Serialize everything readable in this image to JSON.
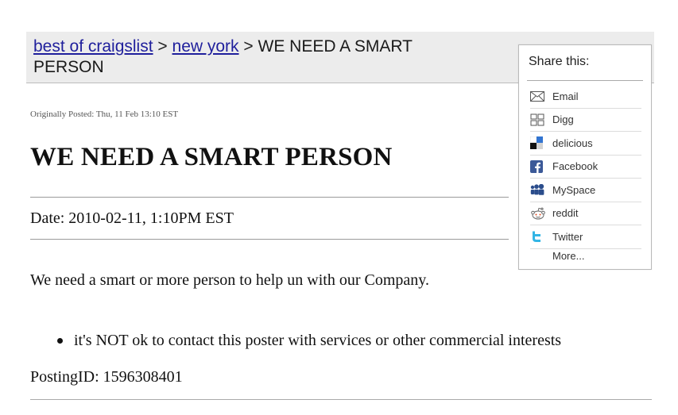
{
  "breadcrumb": {
    "link1": "best of craigslist",
    "sep1": ">",
    "link2": "new york",
    "sep2": ">",
    "current": "WE NEED A SMART PERSON"
  },
  "share": {
    "title": "Share this:",
    "items": [
      {
        "label": "Email",
        "icon": "email-icon"
      },
      {
        "label": "Digg",
        "icon": "digg-icon"
      },
      {
        "label": "delicious",
        "icon": "delicious-icon"
      },
      {
        "label": "Facebook",
        "icon": "facebook-icon"
      },
      {
        "label": "MySpace",
        "icon": "myspace-icon"
      },
      {
        "label": "reddit",
        "icon": "reddit-icon"
      },
      {
        "label": "Twitter",
        "icon": "twitter-icon"
      }
    ],
    "more": "More..."
  },
  "post": {
    "meta": "Originally Posted: Thu, 11 Feb 13:10 EST",
    "title": "WE NEED A SMART PERSON",
    "date": "Date: 2010-02-11, 1:10PM EST",
    "body": "We need a smart or more person to help un with our Company.",
    "bullet": "it's NOT ok to contact this poster with services or other commercial interests",
    "posting_id": "PostingID: 1596308401"
  },
  "colors": {
    "link": "#1f1f9c",
    "header_bg": "#ececec",
    "facebook": "#3b5998",
    "myspace": "#2b4d8c",
    "twitter": "#33b5e5"
  }
}
